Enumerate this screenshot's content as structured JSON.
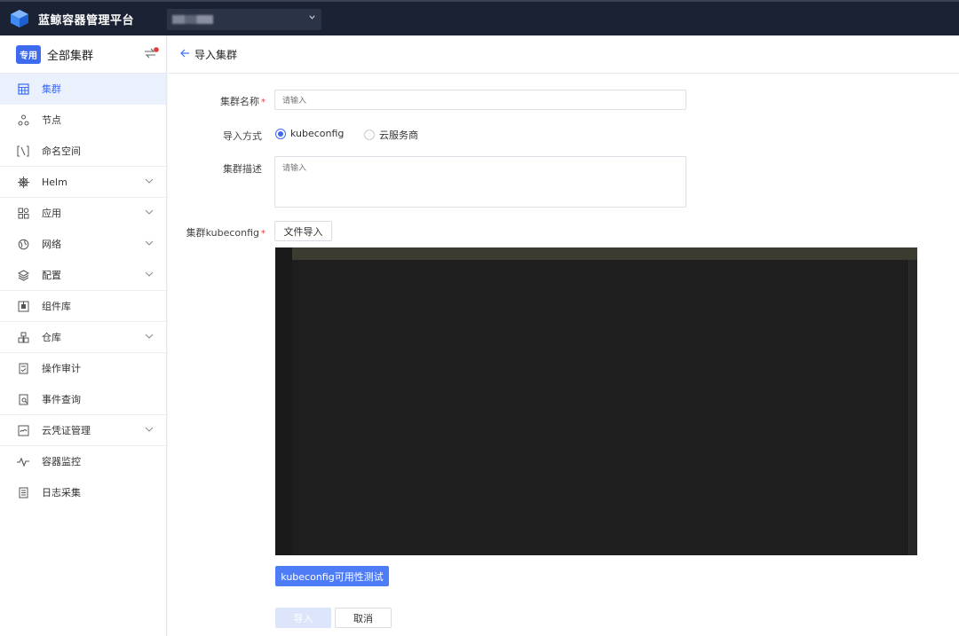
{
  "topbar": {
    "brand": "蓝鲸容器管理平台",
    "env_select_icon": "chevron-down-icon"
  },
  "sidebar": {
    "tag": "专用",
    "title": "全部集群",
    "items": [
      {
        "label": "集群",
        "icon": "grid-calendar-icon",
        "active": true,
        "expandable": false
      },
      {
        "label": "节点",
        "icon": "node-icon",
        "active": false,
        "expandable": false
      },
      {
        "label": "命名空间",
        "icon": "namespace-icon",
        "active": false,
        "expandable": false
      },
      {
        "label": "Helm",
        "icon": "helm-wheel-icon",
        "active": false,
        "expandable": true
      },
      {
        "label": "应用",
        "icon": "apps-icon",
        "active": false,
        "expandable": true
      },
      {
        "label": "网络",
        "icon": "network-icon",
        "active": false,
        "expandable": true
      },
      {
        "label": "配置",
        "icon": "layers-icon",
        "active": false,
        "expandable": true
      },
      {
        "label": "组件库",
        "icon": "component-icon",
        "active": false,
        "expandable": false
      },
      {
        "label": "仓库",
        "icon": "repository-icon",
        "active": false,
        "expandable": true
      },
      {
        "label": "操作审计",
        "icon": "audit-icon",
        "active": false,
        "expandable": false
      },
      {
        "label": "事件查询",
        "icon": "event-icon",
        "active": false,
        "expandable": false
      },
      {
        "label": "云凭证管理",
        "icon": "credential-icon",
        "active": false,
        "expandable": true
      },
      {
        "label": "容器监控",
        "icon": "pulse-icon",
        "active": false,
        "expandable": false
      },
      {
        "label": "日志采集",
        "icon": "log-icon",
        "active": false,
        "expandable": false
      }
    ]
  },
  "main": {
    "title": "导入集群",
    "form": {
      "name_label": "集群名称",
      "name_placeholder": "请输入",
      "method_label": "导入方式",
      "method_options": [
        "kubeconfig",
        "云服务商"
      ],
      "method_selected": "kubeconfig",
      "desc_label": "集群描述",
      "desc_placeholder": "请输入",
      "kubeconfig_label": "集群kubeconfig",
      "file_import": "文件导入",
      "test_button": "kubeconfig可用性测试",
      "submit": "导入",
      "cancel": "取消"
    }
  },
  "colors": {
    "topbar": "#1b2233",
    "accent": "#3d6bf0",
    "editor_bg": "#1e1e1e"
  }
}
